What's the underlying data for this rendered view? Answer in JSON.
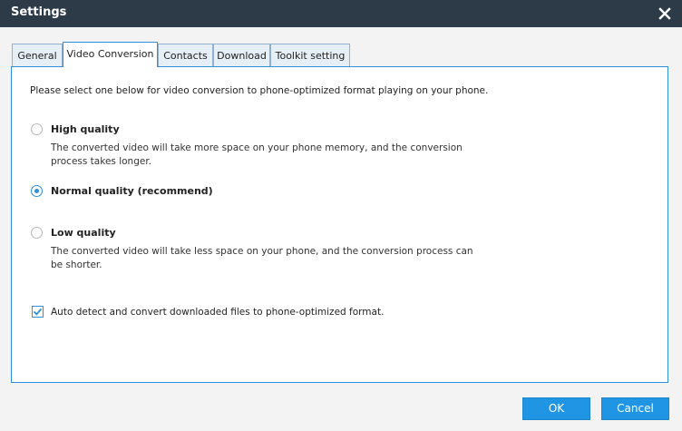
{
  "window": {
    "title": "Settings"
  },
  "tabs": [
    {
      "label": "General"
    },
    {
      "label": "Video Conversion"
    },
    {
      "label": "Contacts"
    },
    {
      "label": "Download"
    },
    {
      "label": "Toolkit setting"
    }
  ],
  "active_tab": "Video Conversion",
  "video_conversion": {
    "intro": "Please select one below for video conversion to phone-optimized format playing on your phone.",
    "options": [
      {
        "label": "High quality",
        "description": "The converted video will take more space on your phone memory, and the conversion process takes longer.",
        "selected": false
      },
      {
        "label": "Normal quality (recommend)",
        "description": "",
        "selected": true
      },
      {
        "label": "Low quality",
        "description": "The converted video will take less space on your phone, and the conversion process can be shorter.",
        "selected": false
      }
    ],
    "auto_detect": {
      "label": "Auto detect and convert downloaded files to phone-optimized format.",
      "checked": true
    }
  },
  "buttons": {
    "ok": "OK",
    "cancel": "Cancel"
  },
  "colors": {
    "titlebar": "#2d3b48",
    "accent": "#2f8fd8",
    "button": "#1f95e3"
  }
}
